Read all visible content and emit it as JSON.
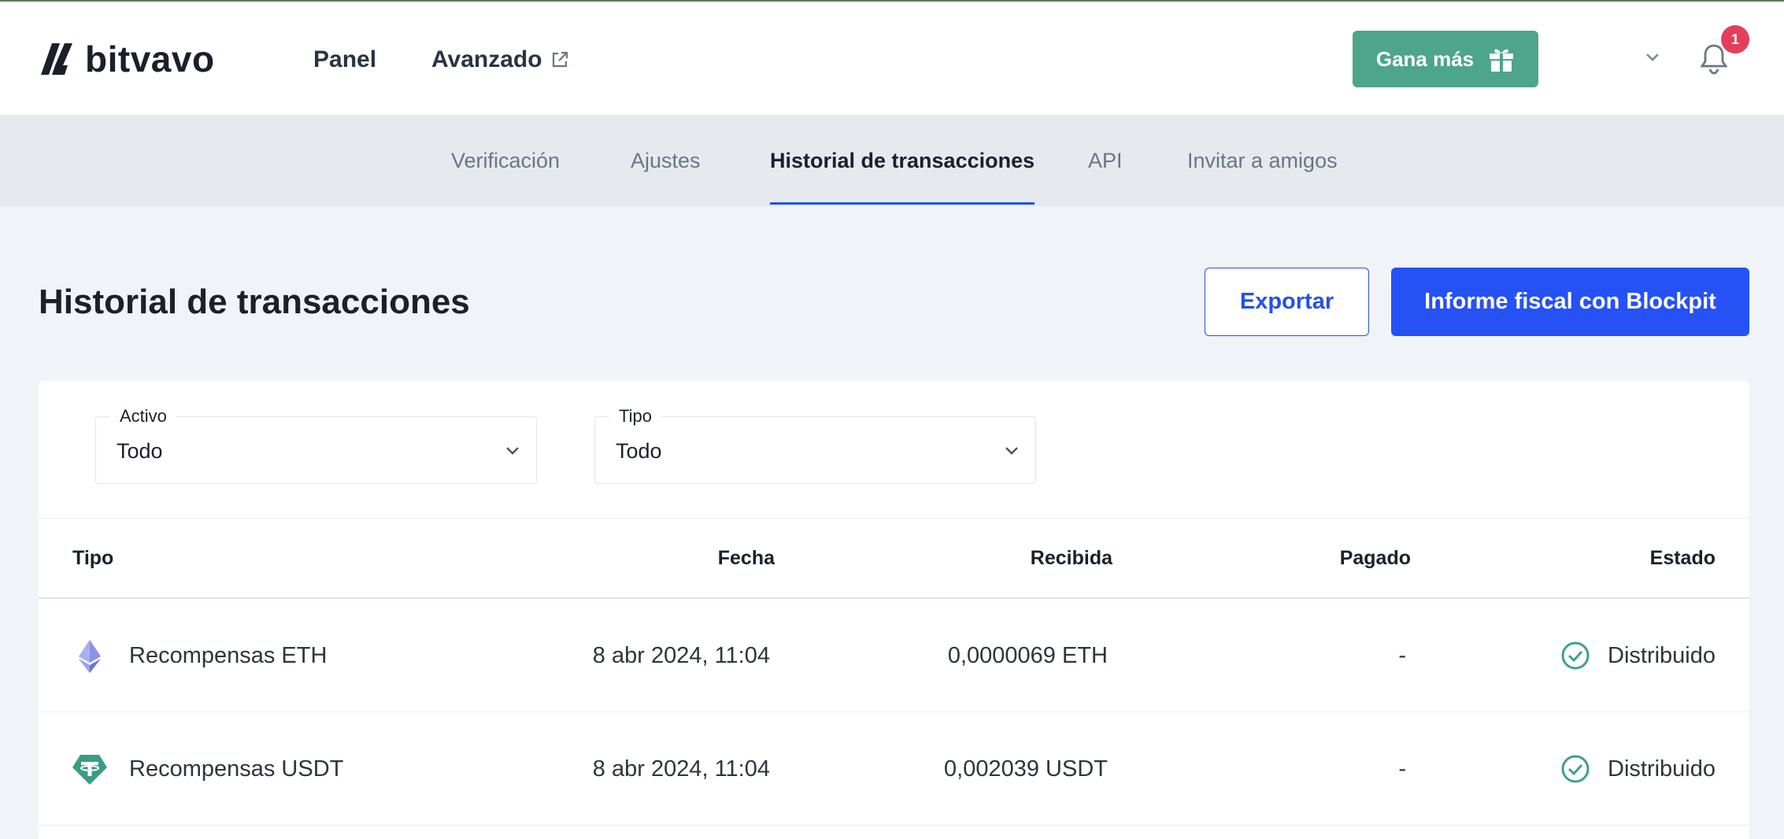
{
  "header": {
    "logo_text": "bitvavo",
    "nav": {
      "panel": "Panel",
      "avanzado": "Avanzado"
    },
    "earn_button": "Gana más",
    "notifications_count": "1",
    "accent_color": "#4da58a"
  },
  "tabs": [
    {
      "label": "Verificación",
      "active": false
    },
    {
      "label": "Ajustes",
      "active": false
    },
    {
      "label": "Historial de transacciones",
      "active": true
    },
    {
      "label": "API",
      "active": false
    },
    {
      "label": "Invitar a amigos",
      "active": false
    }
  ],
  "page": {
    "title": "Historial de transacciones",
    "export_button": "Exportar",
    "tax_button": "Informe fiscal con Blockpit"
  },
  "filters": {
    "asset": {
      "label": "Activo",
      "value": "Todo"
    },
    "type": {
      "label": "Tipo",
      "value": "Todo"
    }
  },
  "table": {
    "columns": {
      "tipo": "Tipo",
      "fecha": "Fecha",
      "recibida": "Recibida",
      "pagado": "Pagado",
      "estado": "Estado"
    },
    "rows": [
      {
        "icon": "eth-icon",
        "tipo": "Recompensas ETH",
        "fecha": "8 abr 2024, 11:04",
        "recibida": "0,0000069 ETH",
        "pagado": "-",
        "estado": "Distribuido"
      },
      {
        "icon": "usdt-icon",
        "tipo": "Recompensas USDT",
        "fecha": "8 abr 2024, 11:04",
        "recibida": "0,002039 USDT",
        "pagado": "-",
        "estado": "Distribuido"
      }
    ]
  }
}
